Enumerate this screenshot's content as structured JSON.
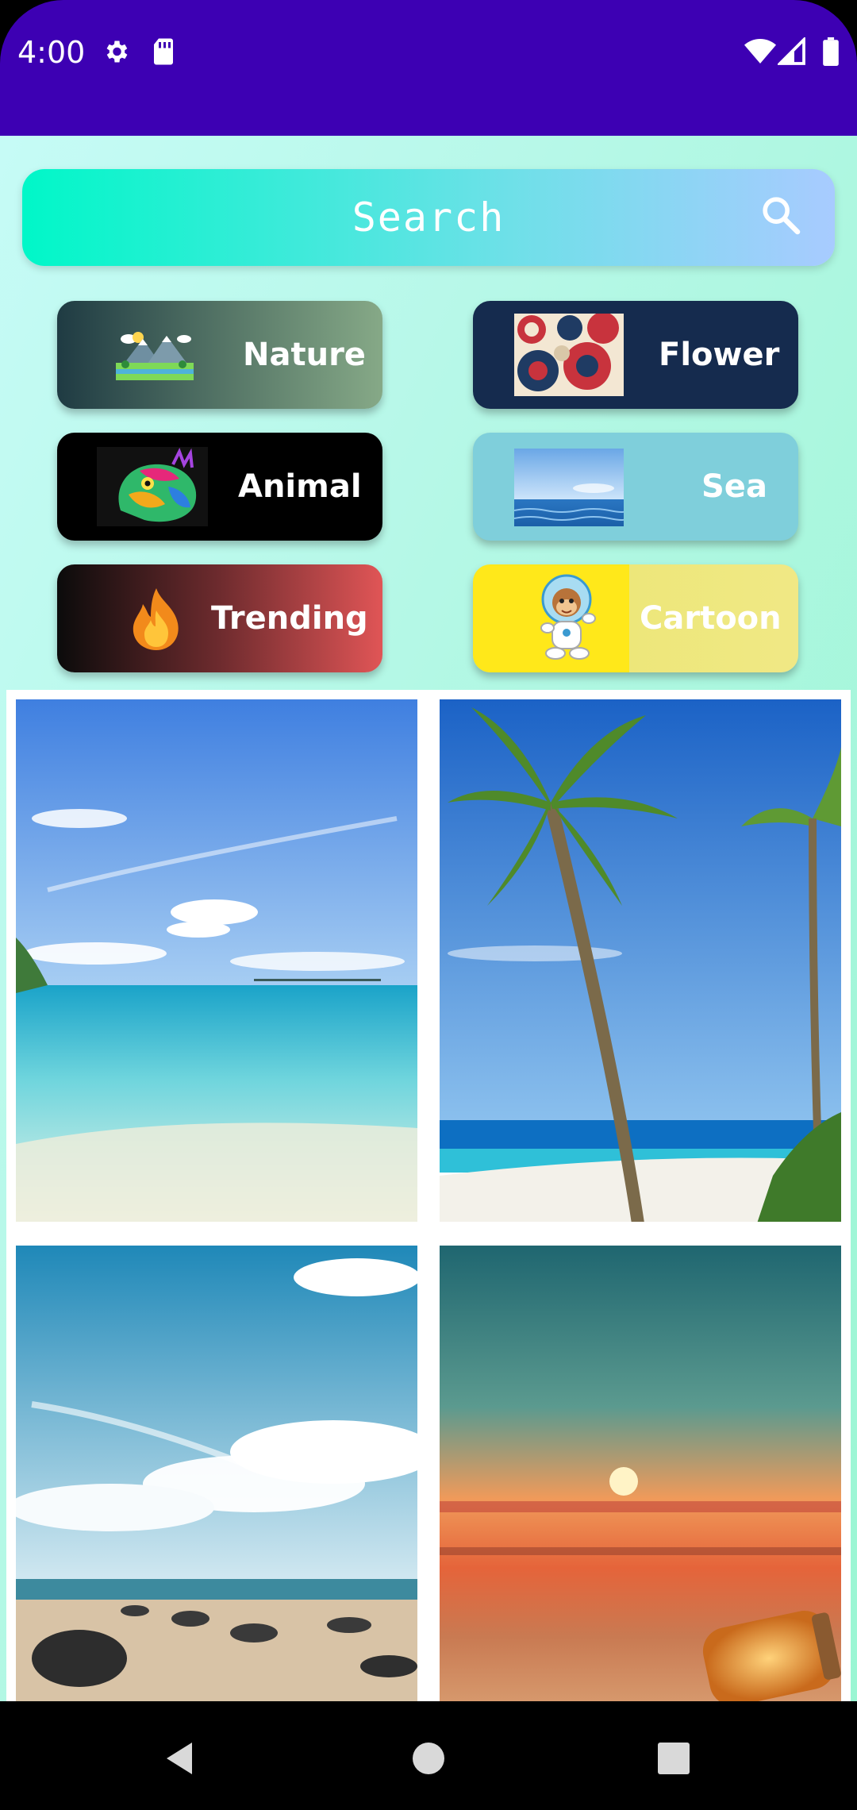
{
  "status_bar": {
    "time": "4:00",
    "icons": [
      "settings-icon",
      "sd-card-icon",
      "wifi-icon",
      "cell-signal-icon",
      "battery-icon"
    ],
    "color": "#3d00b3"
  },
  "search": {
    "placeholder": "Search",
    "icon": "search-icon"
  },
  "categories": [
    {
      "label": "Nature",
      "icon": "landscape-icon"
    },
    {
      "label": "Flower",
      "icon": "flower-pattern-icon"
    },
    {
      "label": "Animal",
      "icon": "iguana-icon"
    },
    {
      "label": "Sea",
      "icon": "sea-horizon-icon"
    },
    {
      "label": "Trending",
      "icon": "fire-icon"
    },
    {
      "label": "Cartoon",
      "icon": "astronaut-monkey-icon"
    }
  ],
  "photos": [
    {
      "subject": "tropical beach with clear water"
    },
    {
      "subject": "palm tree on beach"
    },
    {
      "subject": "rocky beach under cloudy sky"
    },
    {
      "subject": "sunset with glowing jar on sand"
    }
  ],
  "nav_bar": {
    "icons": [
      "back-icon",
      "home-icon",
      "recents-icon"
    ]
  }
}
